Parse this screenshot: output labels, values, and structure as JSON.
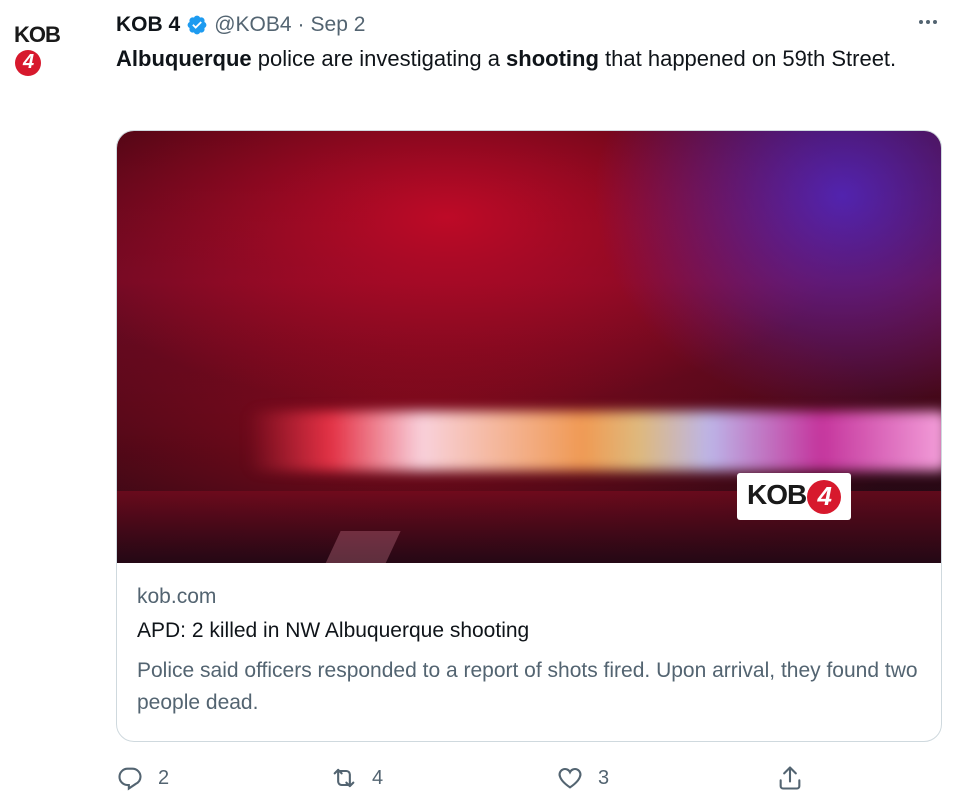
{
  "author": {
    "display_name": "KOB 4",
    "handle": "@KOB4",
    "separator": "·",
    "date": "Sep 2",
    "logo_text": "KOB",
    "logo_number": "4"
  },
  "tweet": {
    "bold_1": "Albuquerque",
    "text_1": " police are investigating a ",
    "bold_2": "shooting",
    "text_2": " that happened on 59th Street."
  },
  "card": {
    "image_logo_text": "KOB",
    "image_logo_number": "4",
    "domain": "kob.com",
    "title": "APD: 2 killed in NW Albuquerque shooting",
    "description": "Police said officers responded to a report of shots fired. Upon arrival, they found two people dead."
  },
  "actions": {
    "reply_count": "2",
    "retweet_count": "4",
    "like_count": "3"
  },
  "icons": {
    "verified": "verified-badge-icon",
    "more": "more-icon",
    "reply": "reply-icon",
    "retweet": "retweet-icon",
    "like": "heart-icon",
    "share": "share-icon"
  },
  "colors": {
    "verified": "#1d9bf0",
    "brand_red": "#d7192d",
    "secondary_text": "#536471",
    "primary_text": "#0f1419"
  }
}
